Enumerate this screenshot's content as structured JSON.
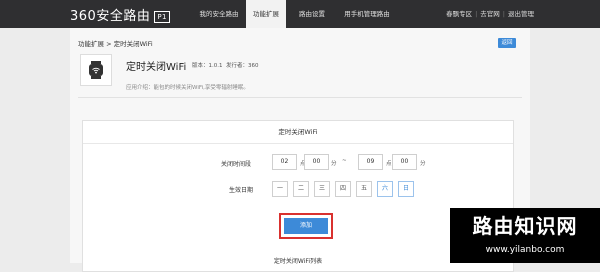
{
  "header": {
    "logo_text": "360安全路由",
    "logo_badge": "P1",
    "nav": [
      {
        "label": "我的安全路由",
        "active": false
      },
      {
        "label": "功能扩展",
        "active": true
      },
      {
        "label": "路由设置",
        "active": false
      },
      {
        "label": "用手机管理路由",
        "active": false
      }
    ],
    "links": [
      "春飘专区",
      "去官网",
      "退出管理"
    ]
  },
  "breadcrumb": "功能扩展 > 定时关闭WiFi",
  "back_label": "返回",
  "app": {
    "icon": "watch-wifi-icon",
    "title": "定时关闭WiFi",
    "version_label": "版本：1.0.1",
    "publisher_label": "发行者：360",
    "description": "应用介绍：能包的时候关闭WiFi,享受零辐射睡眠。"
  },
  "panel": {
    "title": "定时关闭WiFi",
    "time_label": "关闭时间段",
    "start_hour": "02",
    "start_min": "00",
    "end_hour": "09",
    "end_min": "00",
    "unit_hour": "点",
    "unit_min": "分",
    "separator": "~",
    "date_label": "生效日期",
    "days": [
      {
        "label": "一",
        "selected": false
      },
      {
        "label": "二",
        "selected": false
      },
      {
        "label": "三",
        "selected": false
      },
      {
        "label": "四",
        "selected": false
      },
      {
        "label": "五",
        "selected": false
      },
      {
        "label": "六",
        "selected": true
      },
      {
        "label": "日",
        "selected": true
      }
    ],
    "add_label": "添加",
    "list_title": "定时关闭WiFi列表"
  },
  "watermark": {
    "line1": "路由知识网",
    "line2": "www.yilanbo.com"
  },
  "colors": {
    "topbar": "#2f2f31",
    "accent": "#3d8ad8",
    "highlight": "#d9312f"
  }
}
